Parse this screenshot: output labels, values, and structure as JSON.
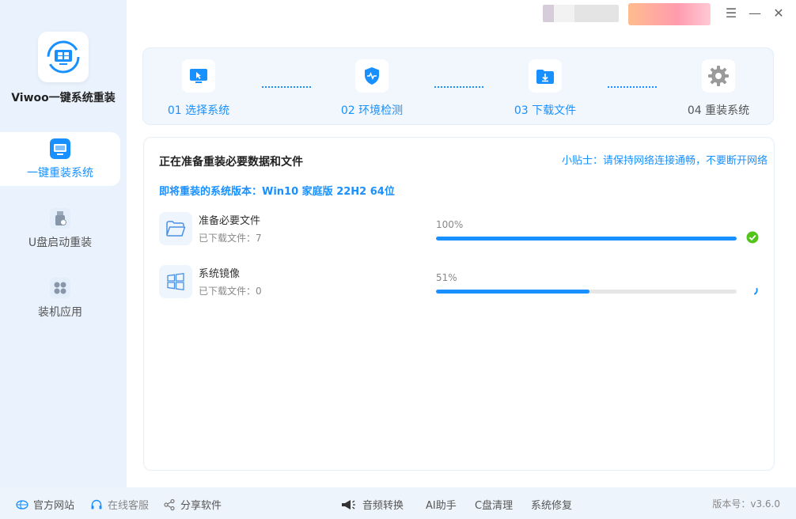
{
  "app": {
    "title": "Viwoo一键系统重装"
  },
  "sidebar": {
    "items": [
      {
        "label": "一键重装系统",
        "active": true
      },
      {
        "label": "U盘启动重装",
        "active": false
      },
      {
        "label": "装机应用",
        "active": false
      }
    ]
  },
  "window": {
    "menu_icon": "☰",
    "minimize_icon": "—",
    "close_icon": "✕"
  },
  "steps": [
    {
      "label": "01 选择系统",
      "icon": "monitor-cursor-icon",
      "state": "done"
    },
    {
      "label": "02 环境检测",
      "icon": "shield-icon",
      "state": "done"
    },
    {
      "label": "03 下载文件",
      "icon": "download-folder-icon",
      "state": "current"
    },
    {
      "label": "04 重装系统",
      "icon": "gear-icon",
      "state": "pending"
    }
  ],
  "content": {
    "title": "正在准备重装必要数据和文件",
    "tip": "小贴士：请保持网络连接通畅，不要断开网络",
    "version_line": "即将重装的系统版本：Win10 家庭版 22H2 64位",
    "tasks": [
      {
        "name": "准备必要文件",
        "count": "已下载文件：7",
        "percent_label": "100%",
        "progress": 100,
        "status": "complete"
      },
      {
        "name": "系统镜像",
        "count": "已下载文件：0",
        "percent_label": "51%",
        "progress": 51,
        "status": "loading"
      }
    ]
  },
  "footer": {
    "links": [
      {
        "label": "官方网站"
      },
      {
        "label": "在线客服"
      },
      {
        "label": "分享软件"
      }
    ],
    "tools": [
      {
        "label": "音频转换"
      },
      {
        "label": "AI助手"
      },
      {
        "label": "C盘清理"
      },
      {
        "label": "系统修复"
      }
    ],
    "version": "版本号：v3.6.0"
  },
  "colors": {
    "accent": "#1890ff",
    "success": "#52c41a",
    "sidebar_bg": "#eaf3fd"
  }
}
